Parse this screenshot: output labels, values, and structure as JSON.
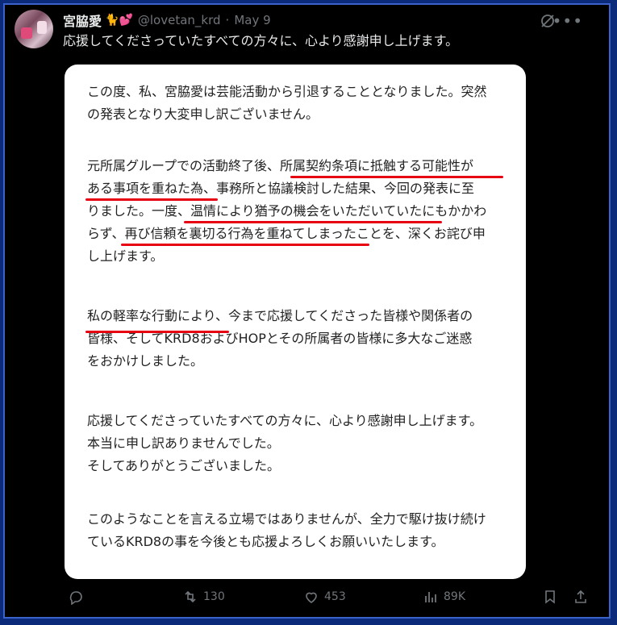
{
  "author": {
    "display_name": "宮脇愛",
    "emojis": "🐈💕",
    "handle": "@lovetan_krd",
    "separator": "·",
    "date": "May 9"
  },
  "tweet": {
    "text": "応援してくださっていたすべての方々に、心より感謝申し上げます。"
  },
  "image_text": {
    "p1": [
      "この度、私、宮脇愛は芸能活動から引退することとなりました。突然",
      "の発表となり大変申し訳ございません。"
    ],
    "p2": [
      "元所属グループでの活動終了後、所属契約条項に抵触する可能性が",
      "ある事項を重ねた為、事務所と協議検討した結果、今回の発表に至",
      "りました。一度、温情により猶予の機会をいただいていたにもかかわ",
      "らず、再び信頼を裏切る行為を重ねてしまったことを、深くお詫び申",
      "し上げます。"
    ],
    "p3": [
      "私の軽率な行動により、今まで応援してくださった皆様や関係者の",
      "皆様、そしてKRD8およびHOPとその所属者の皆様に多大なご迷惑",
      "をおかけしました。"
    ],
    "p4": [
      "応援してくださっていたすべての方々に、心より感謝申し上げます。",
      "本当に申し訳ありませんでした。",
      "そしてありがとうございました。"
    ],
    "p5": [
      "このようなことを言える立場ではありませんが、全力で駆け抜け続け",
      "ているKRD8の事を今後とも応援よろしくお願いいたします。"
    ]
  },
  "actions": {
    "reply_count": "",
    "retweet_count": "130",
    "like_count": "453",
    "views_count": "89K"
  },
  "colors": {
    "underline": "#e60012",
    "frame": "#3a62c9",
    "background": "#000000"
  },
  "icons": [
    "grok-icon",
    "more-icon",
    "reply-icon",
    "retweet-icon",
    "like-icon",
    "views-icon",
    "bookmark-icon",
    "share-icon"
  ]
}
